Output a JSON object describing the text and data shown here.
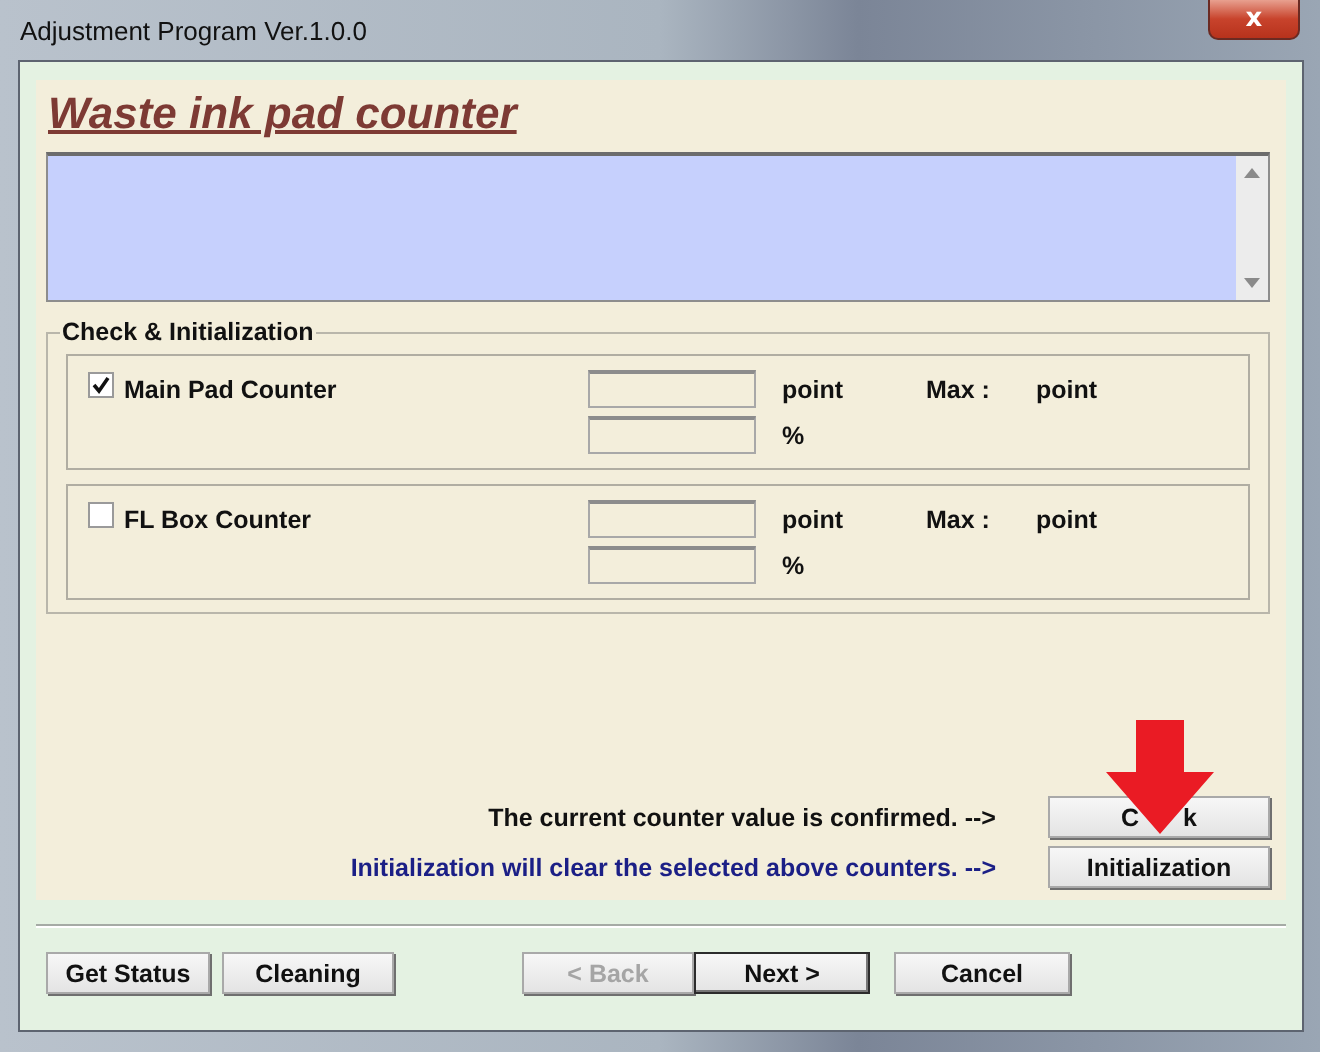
{
  "window": {
    "title": "Adjustment Program Ver.1.0.0",
    "close_icon": "x"
  },
  "heading": "Waste ink pad counter",
  "group": {
    "title": "Check & Initialization",
    "counters": [
      {
        "label": "Main Pad Counter",
        "checked": true,
        "point_unit": "point",
        "percent_unit": "%",
        "max_label": "Max :",
        "max_unit": "point"
      },
      {
        "label": "FL Box Counter",
        "checked": false,
        "point_unit": "point",
        "percent_unit": "%",
        "max_label": "Max :",
        "max_unit": "point"
      }
    ],
    "actions": [
      {
        "kind": "plain",
        "text": "The current counter value is confirmed. -->",
        "button_parts": [
          "C",
          "k"
        ],
        "arrow": true
      },
      {
        "kind": "notice",
        "text": "Initialization will clear the selected above counters. -->",
        "button_parts": [
          "Initialization"
        ],
        "arrow": false
      }
    ]
  },
  "buttons": [
    {
      "label": "Get Status",
      "disabled": false,
      "default": false
    },
    {
      "label": "Cleaning",
      "disabled": false,
      "default": false
    },
    {
      "label": "< Back",
      "disabled": true,
      "default": false
    },
    {
      "label": "Next >",
      "disabled": false,
      "default": true
    },
    {
      "label": "Cancel",
      "disabled": false,
      "default": false
    }
  ]
}
